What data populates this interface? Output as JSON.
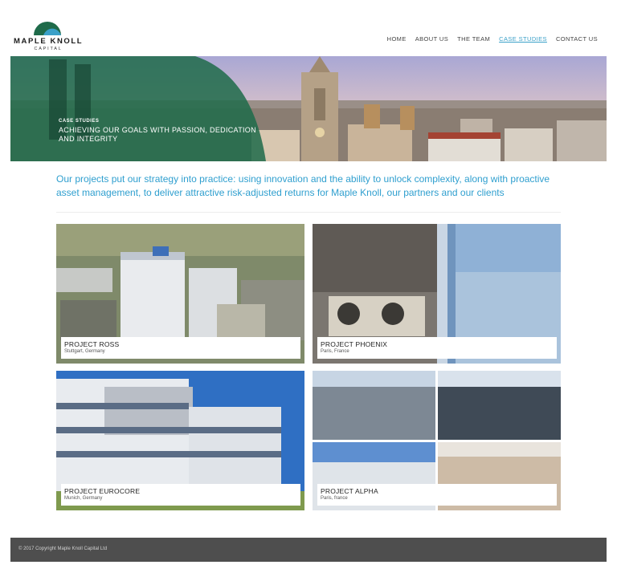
{
  "brand": {
    "name": "MAPLE KNOLL",
    "sub": "CAPITAL",
    "colors": {
      "accent": "#3aa0c8",
      "green": "#1f6b4a",
      "footer": "#4e4e4e"
    }
  },
  "nav": {
    "items": [
      {
        "label": "HOME",
        "active": false
      },
      {
        "label": "ABOUT US",
        "active": false
      },
      {
        "label": "THE TEAM",
        "active": false
      },
      {
        "label": "CASE STUDIES",
        "active": true
      },
      {
        "label": "CONTACT US",
        "active": false
      }
    ]
  },
  "hero": {
    "kicker": "CASE STUDIES",
    "title": "ACHIEVING OUR GOALS WITH PASSION, DEDICATION AND INTEGRITY"
  },
  "intro": {
    "text": "Our projects put our strategy into practice: using innovation and the ability to unlock complexity, along with proactive asset management, to deliver attractive risk-adjusted returns for Maple Knoll, our partners and our clients"
  },
  "projects": [
    {
      "title": "PROJECT ROSS",
      "location": "Stuttgart, Germany"
    },
    {
      "title": "PROJECT PHOENIX",
      "location": "Paris, France"
    },
    {
      "title": "PROJECT EUROCORE",
      "location": "Munich, Germany"
    },
    {
      "title": "PROJECT ALPHA",
      "location": "Paris, france"
    }
  ],
  "footer": {
    "copyright": "© 2017 Copyright Maple Knoll Capital Ltd"
  }
}
